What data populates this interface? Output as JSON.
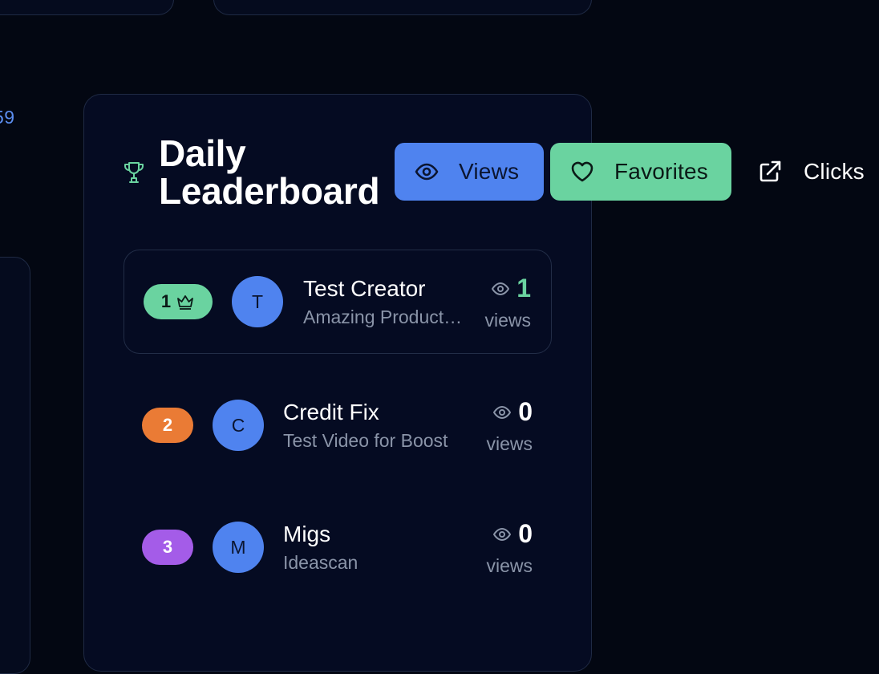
{
  "background": {
    "partial_number": "59"
  },
  "leaderboard": {
    "title": "Daily Leaderboard",
    "icon": "trophy-icon",
    "tabs": [
      {
        "label": "Views",
        "icon": "eye-icon",
        "active": true,
        "color": "#4f83ef"
      },
      {
        "label": "Favorites",
        "icon": "heart-icon",
        "active": false,
        "color": "#6ad3a0"
      },
      {
        "label": "Clicks",
        "icon": "external-link-icon",
        "active": false,
        "color": null
      }
    ],
    "rows": [
      {
        "rank": "1",
        "rank_color": "#6ad3a0",
        "rank_icon": "crown-icon",
        "avatar": "T",
        "name": "Test Creator",
        "subtitle": "Amazing Product…",
        "count": "1",
        "count_color": "#6ad3a0",
        "unit": "views"
      },
      {
        "rank": "2",
        "rank_color": "#ea7b35",
        "avatar": "C",
        "name": "Credit Fix",
        "subtitle": "Test Video for Boost",
        "count": "0",
        "count_color": "#ffffff",
        "unit": "views"
      },
      {
        "rank": "3",
        "rank_color": "#a45ce8",
        "avatar": "M",
        "name": "Migs",
        "subtitle": "Ideascan",
        "count": "0",
        "count_color": "#ffffff",
        "unit": "views"
      }
    ]
  }
}
